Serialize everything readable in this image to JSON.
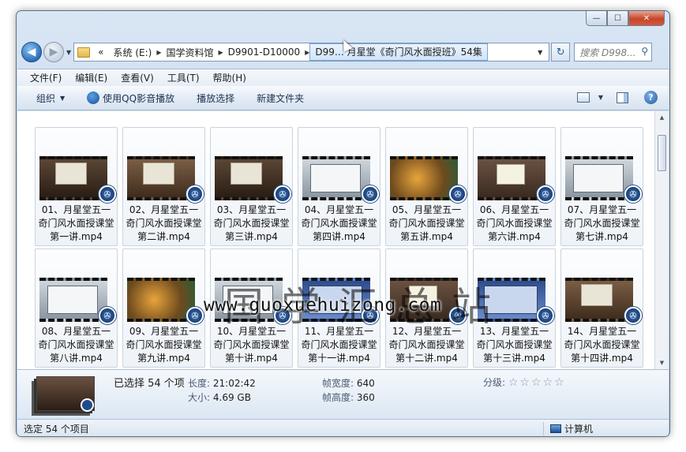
{
  "window": {
    "buttons": {
      "minimize": "—",
      "maximize": "☐",
      "close": "✕"
    }
  },
  "nav": {
    "back_icon": "◀",
    "forward_icon": "▶",
    "breadcrumbs": [
      "«",
      "系统 (E:)",
      "国学资料馆",
      "D9901-D10000",
      "D99… 月星堂《奇门风水面授班》54集"
    ],
    "search_placeholder": "搜索 D998...",
    "refresh_icon": "↻"
  },
  "menu": [
    "文件(F)",
    "编辑(E)",
    "查看(V)",
    "工具(T)",
    "帮助(H)"
  ],
  "commands": {
    "organize": "组织",
    "play_qq": "使用QQ影音播放",
    "play_selected": "播放选择",
    "new_folder": "新建文件夹"
  },
  "files": [
    {
      "name": "01、月星堂五一奇门风水面授课堂第一讲.mp4",
      "thumb": "a"
    },
    {
      "name": "02、月星堂五一奇门风水面授课堂第二讲.mp4",
      "thumb": "b"
    },
    {
      "name": "03、月星堂五一奇门风水面授课堂第三讲.mp4",
      "thumb": "a"
    },
    {
      "name": "04、月星堂五一奇门风水面授课堂第四讲.mp4",
      "thumb": "c"
    },
    {
      "name": "05、月星堂五一奇门风水面授课堂第五讲.mp4",
      "thumb": "d"
    },
    {
      "name": "06、月星堂五一奇门风水面授课堂第六讲.mp4",
      "thumb": "f"
    },
    {
      "name": "07、月星堂五一奇门风水面授课堂第七讲.mp4",
      "thumb": "c"
    },
    {
      "name": "08、月星堂五一奇门风水面授课堂第八讲.mp4",
      "thumb": "c"
    },
    {
      "name": "09、月星堂五一奇门风水面授课堂第九讲.mp4",
      "thumb": "d"
    },
    {
      "name": "10、月星堂五一奇门风水面授课堂第十讲.mp4",
      "thumb": "c"
    },
    {
      "name": "11、月星堂五一奇门风水面授课堂第十一讲.mp4",
      "thumb": "e"
    },
    {
      "name": "12、月星堂五一奇门风水面授课堂第十二讲.mp4",
      "thumb": "f"
    },
    {
      "name": "13、月星堂五一奇门风水面授课堂第十三讲.mp4",
      "thumb": "e"
    },
    {
      "name": "14、月星堂五一奇门风水面授课堂第十四讲.mp4",
      "thumb": "b"
    }
  ],
  "watermark": {
    "cn": "国学汇总站",
    "url": "www.guoxuehuizong.com"
  },
  "details": {
    "selected": "已选择 54 个项",
    "length_label": "长度:",
    "length_value": "21:02:42",
    "size_label": "大小:",
    "size_value": "4.69 GB",
    "frame_width_label": "帧宽度:",
    "frame_width_value": "640",
    "frame_height_label": "帧高度:",
    "frame_height_value": "360",
    "rating_label": "分级:",
    "rating_value": 0,
    "rating_stars": "☆☆☆☆☆"
  },
  "status": {
    "left": "选定 54 个项目",
    "right": "计算机"
  }
}
